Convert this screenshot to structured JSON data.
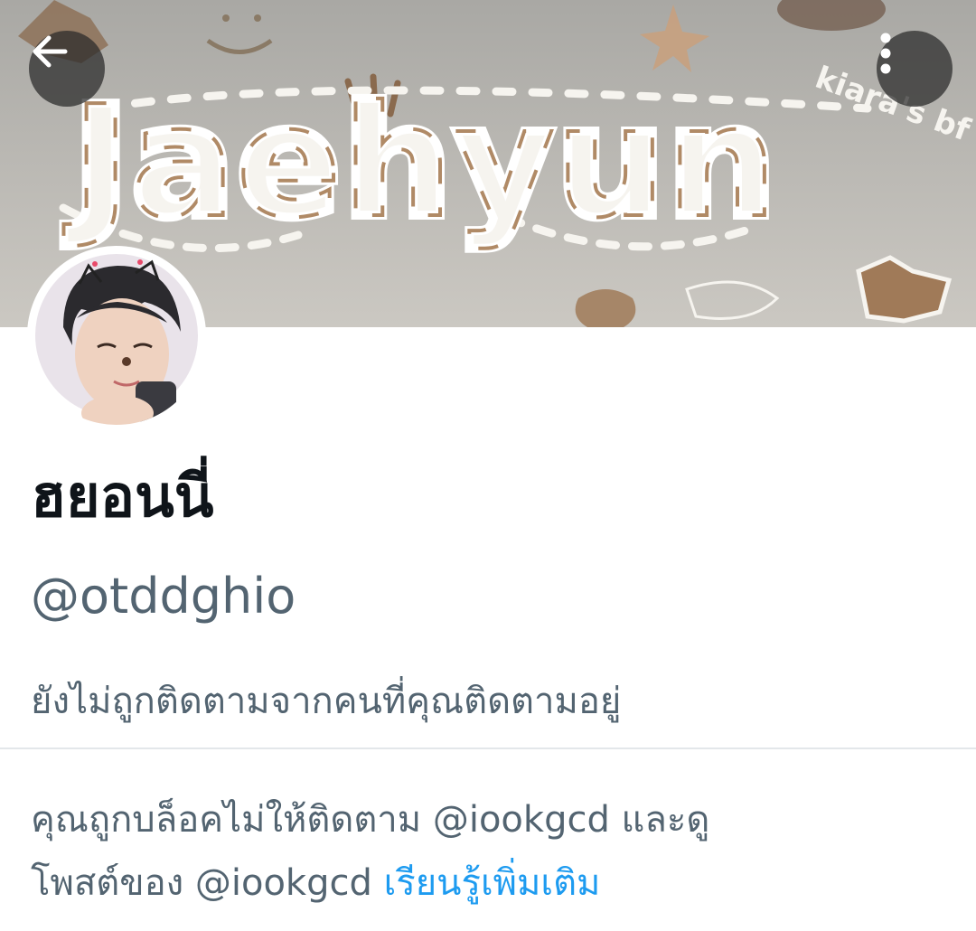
{
  "header": {
    "back_icon": "arrow-left-icon",
    "more_icon": "more-vertical-icon",
    "banner": {
      "title_art": "Jaehyun",
      "side_art": "kiara's bf",
      "colors": {
        "background": "#b5b3ae",
        "letter_fill": "#f6f4ef",
        "letter_accent": "#b08a66"
      }
    }
  },
  "profile": {
    "display_name": "ฮยอนนี่",
    "handle": "@otddghio",
    "not_followed_text": "ยังไม่ถูกติดตามจากคนที่คุณติดตามอยู่"
  },
  "blocked_notice": {
    "line1": "คุณถูกบล็อคไม่ให้ติดตาม @iookgcd และดู",
    "line2": "โพสต์ของ @iookgcd",
    "learn_more": "เรียนรู้เพิ่มเติม"
  },
  "colors": {
    "text_primary": "#0f1419",
    "text_secondary": "#536471",
    "link": "#1d9bf0",
    "divider": "#e3e7ea"
  }
}
